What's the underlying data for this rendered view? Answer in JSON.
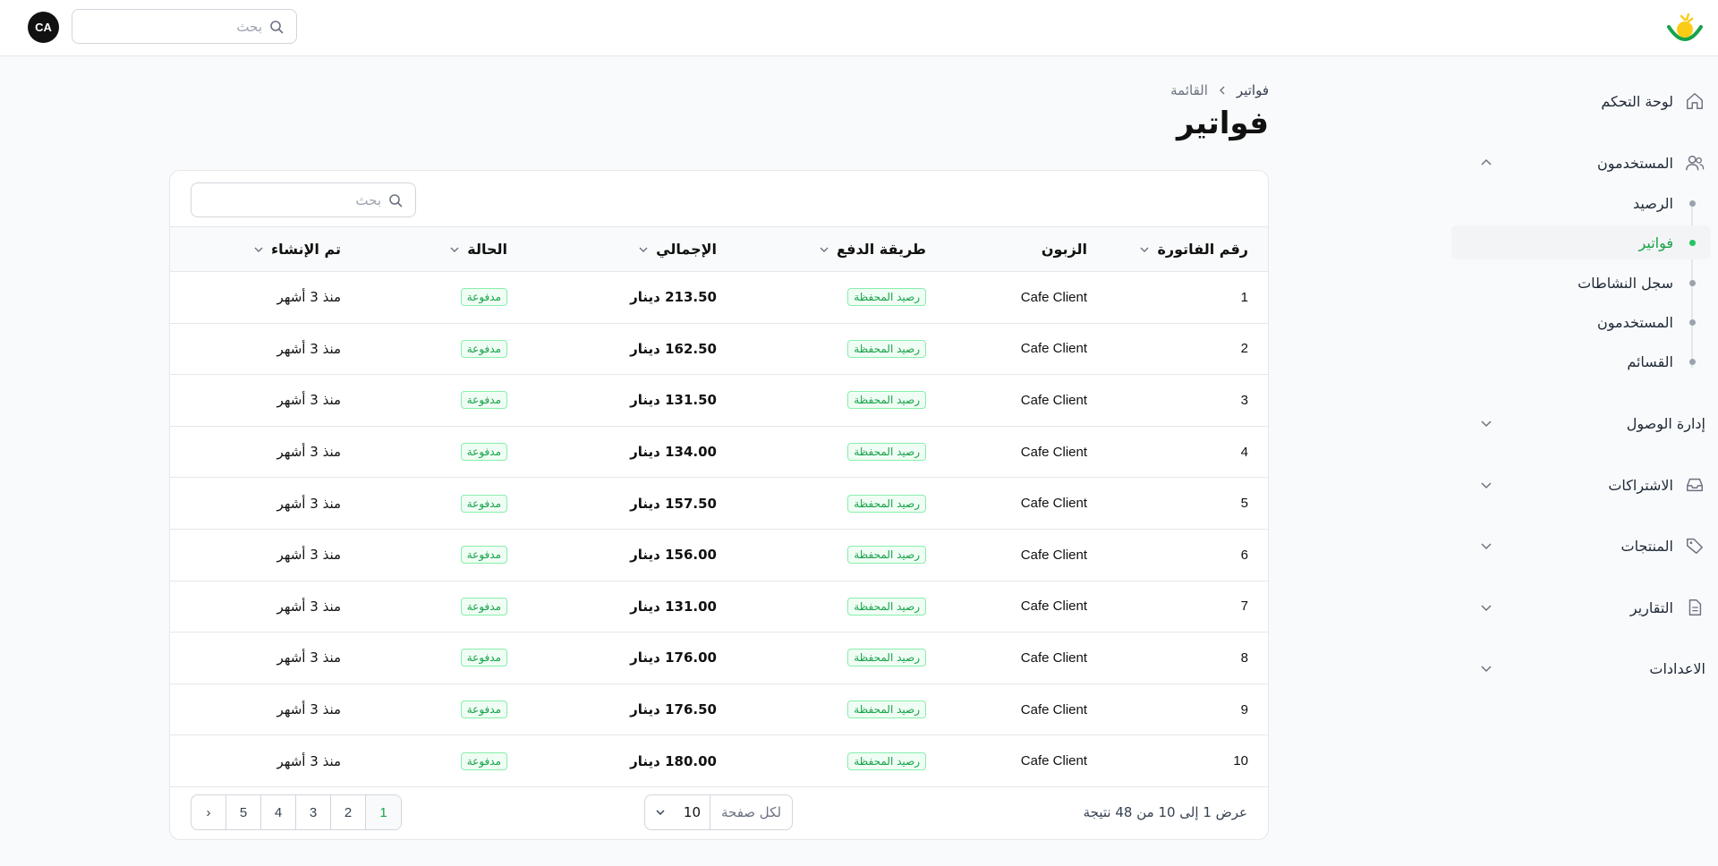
{
  "header": {
    "search_placeholder": "بحث",
    "avatar_initials": "CA"
  },
  "sidebar": {
    "dashboard": "لوحة التحكم",
    "users_group": "المستخدمون",
    "sub_items": [
      {
        "label": "الرصيد",
        "active": false
      },
      {
        "label": "فواتير",
        "active": true
      },
      {
        "label": "سجل النشاطات",
        "active": false
      },
      {
        "label": "المستخدمون",
        "active": false
      },
      {
        "label": "القسائم",
        "active": false
      }
    ],
    "access": "إدارة الوصول",
    "subscriptions": "الاشتراكات",
    "products": "المنتجات",
    "reports": "التقارير",
    "settings": "الاعدادات"
  },
  "breadcrumb": {
    "current": "فواتير",
    "parent": "القائمة"
  },
  "page": {
    "title": "فواتير"
  },
  "table": {
    "search_placeholder": "بحث",
    "columns": {
      "invoice_no": "رقم الفاتورة",
      "customer": "الزبون",
      "payment": "طريقة الدفع",
      "total": "الإجمالي",
      "status": "الحالة",
      "created": "تم الإنشاء"
    },
    "rows": [
      {
        "no": "1",
        "customer": "Cafe Client",
        "payment": "رصيد المحفظة",
        "total": "213.50 دينار",
        "status": "مدفوعة",
        "created": "منذ 3 أشهر"
      },
      {
        "no": "2",
        "customer": "Cafe Client",
        "payment": "رصيد المحفظة",
        "total": "162.50 دينار",
        "status": "مدفوعة",
        "created": "منذ 3 أشهر"
      },
      {
        "no": "3",
        "customer": "Cafe Client",
        "payment": "رصيد المحفظة",
        "total": "131.50 دينار",
        "status": "مدفوعة",
        "created": "منذ 3 أشهر"
      },
      {
        "no": "4",
        "customer": "Cafe Client",
        "payment": "رصيد المحفظة",
        "total": "134.00 دينار",
        "status": "مدفوعة",
        "created": "منذ 3 أشهر"
      },
      {
        "no": "5",
        "customer": "Cafe Client",
        "payment": "رصيد المحفظة",
        "total": "157.50 دينار",
        "status": "مدفوعة",
        "created": "منذ 3 أشهر"
      },
      {
        "no": "6",
        "customer": "Cafe Client",
        "payment": "رصيد المحفظة",
        "total": "156.00 دينار",
        "status": "مدفوعة",
        "created": "منذ 3 أشهر"
      },
      {
        "no": "7",
        "customer": "Cafe Client",
        "payment": "رصيد المحفظة",
        "total": "131.00 دينار",
        "status": "مدفوعة",
        "created": "منذ 3 أشهر"
      },
      {
        "no": "8",
        "customer": "Cafe Client",
        "payment": "رصيد المحفظة",
        "total": "176.00 دينار",
        "status": "مدفوعة",
        "created": "منذ 3 أشهر"
      },
      {
        "no": "9",
        "customer": "Cafe Client",
        "payment": "رصيد المحفظة",
        "total": "176.50 دينار",
        "status": "مدفوعة",
        "created": "منذ 3 أشهر"
      },
      {
        "no": "10",
        "customer": "Cafe Client",
        "payment": "رصيد المحفظة",
        "total": "180.00 دينار",
        "status": "مدفوعة",
        "created": "منذ 3 أشهر"
      }
    ]
  },
  "footer": {
    "results_text": "عرض 1 إلى 10 من 48 نتيجة",
    "per_page_label": "لكل صفحة",
    "per_page_value": "10",
    "pages": [
      "1",
      "2",
      "3",
      "4",
      "5"
    ],
    "current_page": "1",
    "next_symbol": "›"
  },
  "colors": {
    "accent": "#16a34a",
    "badge_border": "#86efac"
  }
}
